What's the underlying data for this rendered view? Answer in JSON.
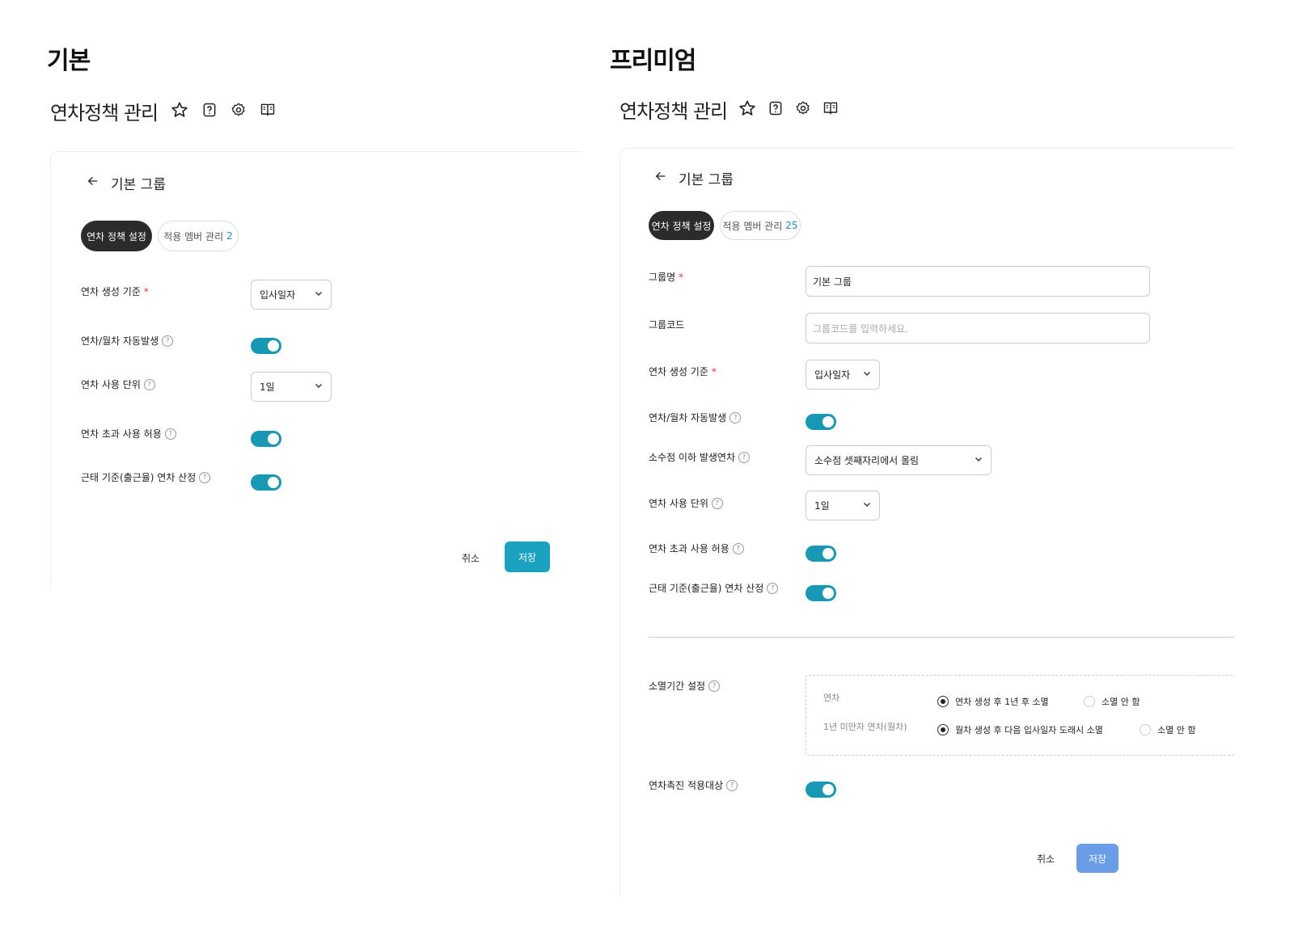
{
  "basic": {
    "section_title": "기본",
    "page_title": "연차정책 관리",
    "group_title": "기본 그룹",
    "tabs": {
      "active": "연차 정책 설정",
      "members": "적용 멤버 관리",
      "members_count": "2"
    },
    "rows": {
      "basis_label": "연차 생성 기준",
      "basis_value": "입사일자",
      "auto_label": "연차/월차 자동발생",
      "unit_label": "연차 사용 단위",
      "unit_value": "1일",
      "over_label": "연차 초과 사용 허용",
      "attendance_label": "근태 기준(출근율) 연차 산정"
    },
    "cancel": "취소",
    "save": "저장"
  },
  "premium": {
    "section_title": "프리미엄",
    "page_title": "연차정책 관리",
    "group_title": "기본 그룹",
    "tabs": {
      "active": "연차 정책 설정",
      "members": "적용 멤버 관리",
      "members_count": "25"
    },
    "rows": {
      "name_label": "그룹명",
      "name_value": "기본 그룹",
      "code_label": "그룹코드",
      "code_placeholder": "그룹코드를 입력하세요.",
      "basis_label": "연차 생성 기준",
      "basis_value": "입사일자",
      "auto_label": "연차/월차 자동발생",
      "decimal_label": "소수점 이하 발생연차",
      "decimal_value": "소수점 셋째자리에서 올림",
      "unit_label": "연차 사용 단위",
      "unit_value": "1일",
      "over_label": "연차 초과 사용 허용",
      "attendance_label": "근태 기준(출근율) 연차 산정",
      "expire_label": "소멸기간 설정",
      "expire_annual_label": "연차",
      "expire_annual_opt1": "연차 생성 후 1년 후 소멸",
      "expire_annual_opt2": "소멸 안 함",
      "expire_monthly_label": "1년 미만자 연차(월차)",
      "expire_monthly_opt1": "월차 생성 후 다음 입사일자 도래시 소멸",
      "expire_monthly_opt2": "소멸 안 함",
      "promote_label": "연차촉진 적용대상"
    },
    "cancel": "취소",
    "save": "저장"
  },
  "colors": {
    "toggle_on": "#1798b4",
    "save_basic": "#1aa2c0",
    "save_premium": "#6a9de8",
    "accent_count": "#1a8ccc",
    "required": "#e53935"
  },
  "icons": [
    "star-icon",
    "help-square-icon",
    "gear-icon",
    "book-icon",
    "arrow-left-icon",
    "chevron-down-icon",
    "question-circle-icon"
  ]
}
